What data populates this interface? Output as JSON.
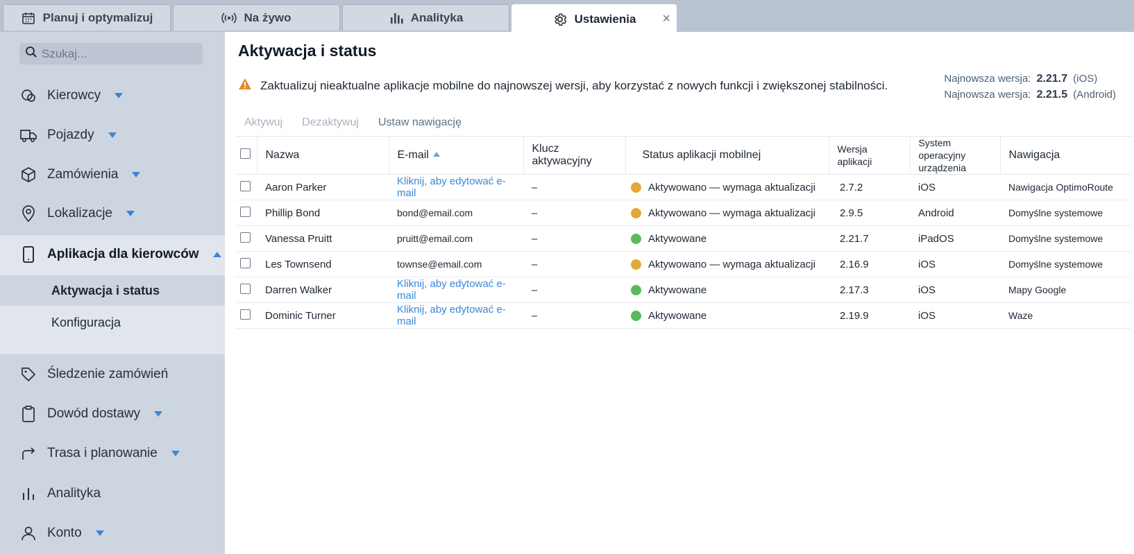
{
  "tabs": [
    {
      "label": "Planuj i optymalizuj",
      "icon": "calendar-icon"
    },
    {
      "label": "Na żywo",
      "icon": "broadcast-icon"
    },
    {
      "label": "Analityka",
      "icon": "bar-chart-icon"
    },
    {
      "label": "Ustawienia",
      "icon": "gear-icon",
      "active": true,
      "close": "×"
    }
  ],
  "sidebar": {
    "search_placeholder": "Szukaj...",
    "items": [
      {
        "label": "Kierowcy",
        "icon": "drivers-icon"
      },
      {
        "label": "Pojazdy",
        "icon": "truck-icon"
      },
      {
        "label": "Zamówienia",
        "icon": "box-icon"
      },
      {
        "label": "Lokalizacje",
        "icon": "map-pin-icon"
      },
      {
        "label": "Aplikacja dla kierowców",
        "icon": "phone-icon"
      },
      {
        "label": "Śledzenie zamówień",
        "icon": "tag-icon"
      },
      {
        "label": "Dowód dostawy",
        "icon": "clipboard-icon"
      },
      {
        "label": "Trasa i planowanie",
        "icon": "route-icon"
      },
      {
        "label": "Analityka",
        "icon": "bar-chart-icon"
      },
      {
        "label": "Konto",
        "icon": "user-icon"
      }
    ],
    "sub_items": [
      "Aktywacja i status",
      "Konfiguracja"
    ]
  },
  "main": {
    "title": "Aktywacja i status",
    "warning": "Zaktualizuj nieaktualne aplikacje mobilne do najnowszej wersji, aby korzystać z nowych funkcji i zwiększonej stabilności.",
    "versions": [
      {
        "label": "Najnowsza wersja:",
        "value": "2.21.7",
        "platform": "(iOS)"
      },
      {
        "label": "Najnowsza wersja:",
        "value": "2.21.5",
        "platform": "(Android)"
      }
    ],
    "toolbar": {
      "activate": "Aktywuj",
      "deactivate": "Dezaktywuj",
      "set_nav": "Ustaw nawigację"
    },
    "columns": [
      "Nazwa",
      "E-mail",
      "Klucz aktywacyjny",
      "Status aplikacji mobilnej",
      "Wersja aplikacji",
      "System operacyjny urządzenia",
      "Nawigacja"
    ],
    "status_colors": {
      "update": "#e3a83a",
      "ok": "#5cb85c"
    },
    "rows": [
      {
        "name": "Aaron Parker",
        "email": "Kliknij, aby edytować e-mail",
        "email_link": true,
        "key": "–",
        "status": "Aktywowano — wymaga aktualizacji",
        "status_type": "update",
        "version": "2.7.2",
        "os": "iOS",
        "nav": "Nawigacja OptimoRoute"
      },
      {
        "name": "Phillip Bond",
        "email": "bond@email.com",
        "email_link": false,
        "key": "–",
        "status": "Aktywowano — wymaga aktualizacji",
        "status_type": "update",
        "version": "2.9.5",
        "os": "Android",
        "nav": "Domyślne systemowe"
      },
      {
        "name": "Vanessa Pruitt",
        "email": "pruitt@email.com",
        "email_link": false,
        "key": "–",
        "status": "Aktywowane",
        "status_type": "ok",
        "version": "2.21.7",
        "os": "iPadOS",
        "nav": "Domyślne systemowe"
      },
      {
        "name": "Les Townsend",
        "email": "townse@email.com",
        "email_link": false,
        "key": "–",
        "status": "Aktywowano — wymaga aktualizacji",
        "status_type": "update",
        "version": "2.16.9",
        "os": "iOS",
        "nav": "Domyślne systemowe"
      },
      {
        "name": "Darren Walker",
        "email": "Kliknij, aby edytować e-mail",
        "email_link": true,
        "key": "–",
        "status": "Aktywowane",
        "status_type": "ok",
        "version": "2.17.3",
        "os": "iOS",
        "nav": "Mapy Google"
      },
      {
        "name": "Dominic Turner",
        "email": "Kliknij, aby edytować e-mail",
        "email_link": true,
        "key": "–",
        "status": "Aktywowane",
        "status_type": "ok",
        "version": "2.19.9",
        "os": "iOS",
        "nav": "Waze"
      }
    ]
  }
}
